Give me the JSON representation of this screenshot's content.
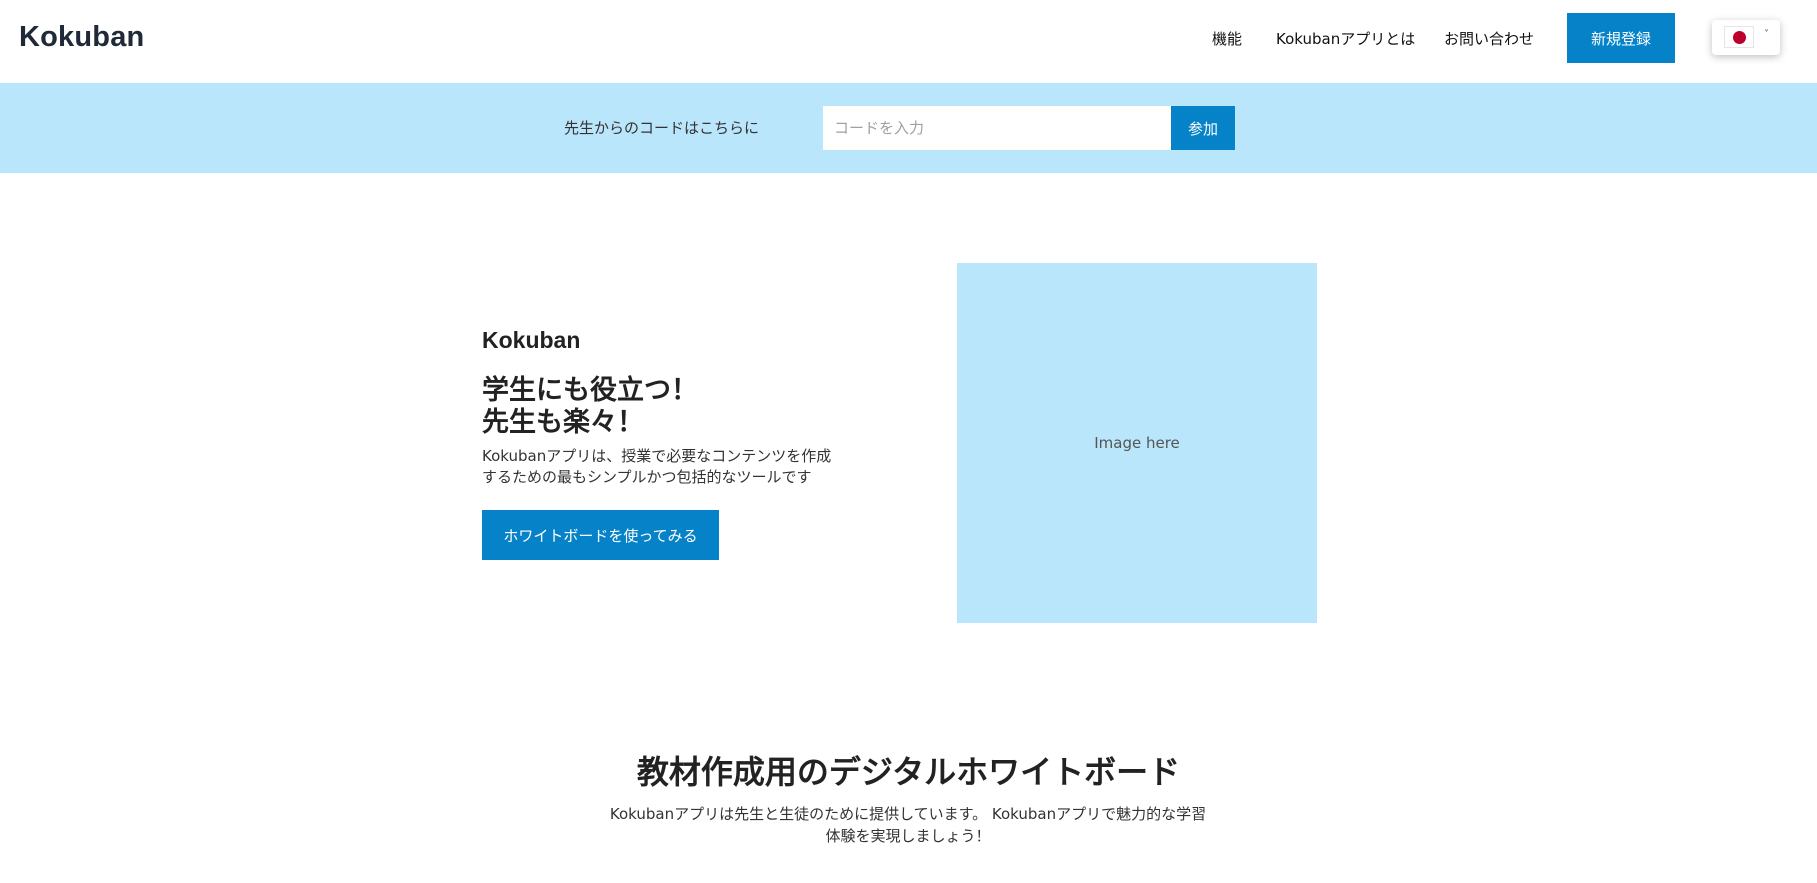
{
  "header": {
    "logo": "Kokuban",
    "nav": {
      "features": "機能",
      "about": "Kokubanアプリとは",
      "contact": "お問い合わせ"
    },
    "signup_label": "新規登録",
    "language": {
      "flag": "japan-flag-icon",
      "chevron": "˅"
    }
  },
  "code_bar": {
    "label": "先生からのコードはこちらに",
    "placeholder": "コードを入力",
    "value": "",
    "join_label": "参加"
  },
  "hero": {
    "app_name": "Kokuban",
    "heading_line1": "学生にも役立つ！",
    "heading_line2": "先生も楽々！",
    "description": "Kokubanアプリは、授業で必要なコンテンツを作成するための最もシンプルかつ包括的なツールです",
    "cta_label": "ホワイトボードを使ってみる",
    "image_placeholder": "Image here"
  },
  "section": {
    "title": "教材作成用のデジタルホワイトボード",
    "description": "Kokubanアプリは先生と生徒のために提供しています。 Kokubanアプリで魅力的な学習体験を実現しましょう！"
  },
  "colors": {
    "accent": "#0683c8",
    "light_blue": "#bae6fb",
    "logo_text": "#1f2937"
  }
}
